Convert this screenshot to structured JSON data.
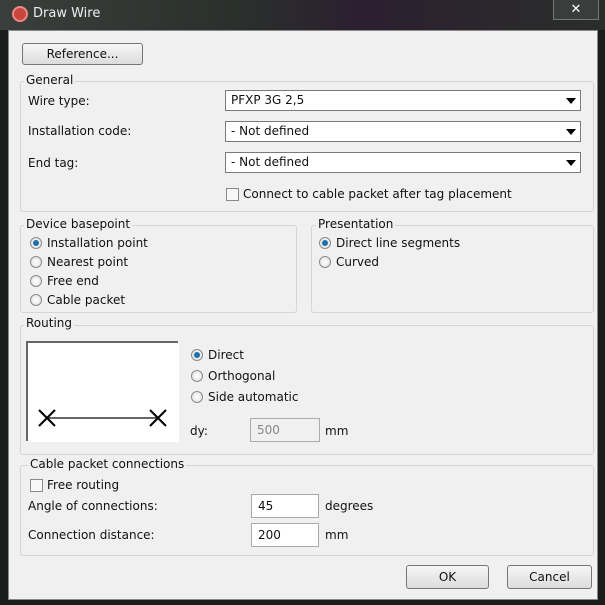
{
  "window": {
    "title": "Draw Wire",
    "close_icon": "close-icon"
  },
  "reference_button": "Reference...",
  "general": {
    "label": "General",
    "wire_type": {
      "label": "Wire type:",
      "value": "PFXP 3G 2,5"
    },
    "installation_code": {
      "label": "Installation code:",
      "value": "- Not defined"
    },
    "end_tag": {
      "label": "End tag:",
      "value": "- Not defined"
    },
    "connect_checkbox": {
      "label": "Connect to cable packet after tag placement",
      "checked": false
    }
  },
  "device_basepoint": {
    "label": "Device basepoint",
    "options": [
      "Installation point",
      "Nearest point",
      "Free end",
      "Cable packet"
    ],
    "selected": "Installation point"
  },
  "presentation": {
    "label": "Presentation",
    "options": [
      "Direct line segments",
      "Curved"
    ],
    "selected": "Direct line segments"
  },
  "routing": {
    "label": "Routing",
    "options": [
      "Direct",
      "Orthogonal",
      "Side automatic"
    ],
    "selected": "Direct",
    "dy_label": "dy:",
    "dy_value": "500",
    "dy_unit": "mm"
  },
  "cable_packet": {
    "label": "Cable packet connections",
    "free_routing": {
      "label": "Free routing",
      "checked": false
    },
    "angle": {
      "label": "Angle of connections:",
      "value": "45",
      "unit": "degrees"
    },
    "distance": {
      "label": "Connection distance:",
      "value": "200",
      "unit": "mm"
    }
  },
  "buttons": {
    "ok": "OK",
    "cancel": "Cancel"
  }
}
